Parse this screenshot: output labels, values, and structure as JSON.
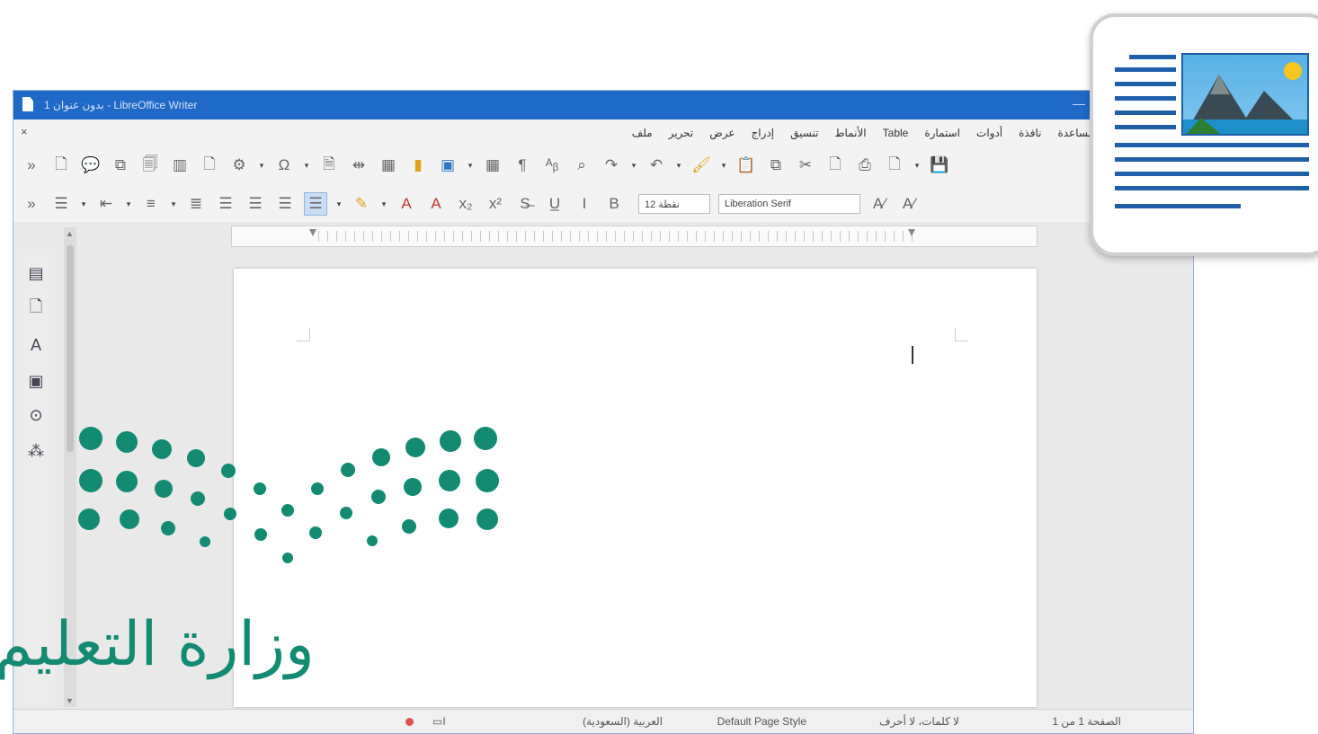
{
  "window": {
    "title": "1 بدون عنوان - LibreOffice Writer",
    "accent_color": "#1f69c7"
  },
  "menu": {
    "items": [
      "ملف",
      "تحرير",
      "عرض",
      "إدراج",
      "تنسيق",
      "الأنماط",
      "Table",
      "استمارة",
      "أدوات",
      "نافذة",
      "مساعدة"
    ]
  },
  "toolbar1": {
    "icons": [
      "overflow-chevron-icon",
      "new-document-icon",
      "open-icon",
      "save-icon",
      "export-pdf-icon",
      "print-icon",
      "print-preview-icon",
      "cut-icon",
      "copy-icon",
      "paste-icon",
      "clone-formatting-icon",
      "clear-formatting-icon",
      "undo-icon",
      "redo-icon",
      "find-replace-icon",
      "spelling-icon",
      "formatting-marks-icon",
      "insert-table-icon",
      "insert-image-icon",
      "insert-chart-icon",
      "insert-textbox-icon",
      "page-break-icon",
      "insert-field-icon",
      "special-character-icon",
      "hyperlink-icon",
      "footnote-icon",
      "comment-icon"
    ]
  },
  "toolbar2": {
    "font_name": "Liberation Serif",
    "font_size": "12 نقطة",
    "icons": [
      "overflow-chevron-icon",
      "paragraph-style-icon",
      "bold-icon",
      "italic-icon",
      "underline-icon",
      "strikethrough-icon",
      "superscript-icon",
      "subscript-icon",
      "clear-direct-formatting-icon",
      "font-color-icon",
      "highlight-color-icon",
      "align-left-icon",
      "align-center-icon",
      "align-right-icon",
      "justify-icon",
      "unordered-list-icon",
      "ordered-list-icon",
      "increase-indent-icon",
      "decrease-indent-icon",
      "line-spacing-icon"
    ]
  },
  "sidebar": {
    "icons": [
      "properties-icon",
      "page-icon",
      "styles-icon",
      "gallery-icon",
      "navigator-icon",
      "manage-changes-icon"
    ]
  },
  "statusbar": {
    "page_info": "الصفحة 1 من 1",
    "word_count": "لا كلمات، لا أحرف",
    "page_style": "Default Page Style",
    "language": "العربية (السعودية)"
  },
  "logo": {
    "text": "وزارة التعليم",
    "color": "#138a72"
  },
  "inset": {
    "bar_color": "#1e5fa8"
  }
}
